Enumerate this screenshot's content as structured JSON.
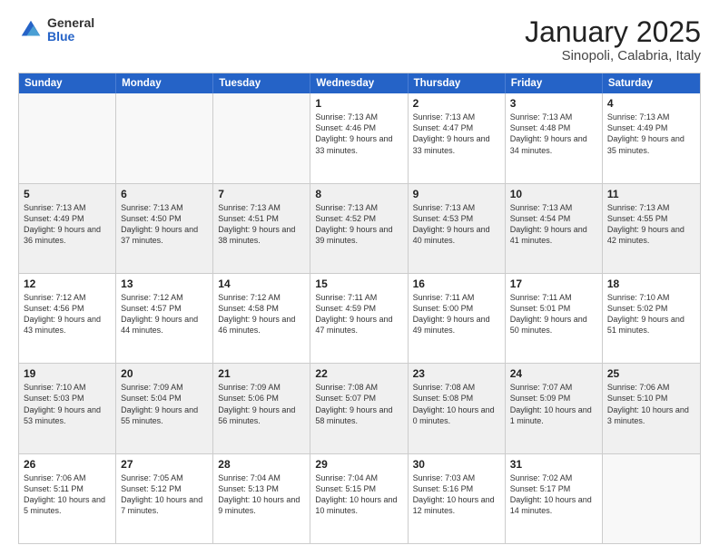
{
  "logo": {
    "general": "General",
    "blue": "Blue"
  },
  "header": {
    "month": "January 2025",
    "location": "Sinopoli, Calabria, Italy"
  },
  "weekdays": [
    "Sunday",
    "Monday",
    "Tuesday",
    "Wednesday",
    "Thursday",
    "Friday",
    "Saturday"
  ],
  "rows": [
    [
      {
        "day": "",
        "info": "",
        "shaded": false,
        "empty": true
      },
      {
        "day": "",
        "info": "",
        "shaded": false,
        "empty": true
      },
      {
        "day": "",
        "info": "",
        "shaded": false,
        "empty": true
      },
      {
        "day": "1",
        "info": "Sunrise: 7:13 AM\nSunset: 4:46 PM\nDaylight: 9 hours and 33 minutes.",
        "shaded": false,
        "empty": false
      },
      {
        "day": "2",
        "info": "Sunrise: 7:13 AM\nSunset: 4:47 PM\nDaylight: 9 hours and 33 minutes.",
        "shaded": false,
        "empty": false
      },
      {
        "day": "3",
        "info": "Sunrise: 7:13 AM\nSunset: 4:48 PM\nDaylight: 9 hours and 34 minutes.",
        "shaded": false,
        "empty": false
      },
      {
        "day": "4",
        "info": "Sunrise: 7:13 AM\nSunset: 4:49 PM\nDaylight: 9 hours and 35 minutes.",
        "shaded": false,
        "empty": false
      }
    ],
    [
      {
        "day": "5",
        "info": "Sunrise: 7:13 AM\nSunset: 4:49 PM\nDaylight: 9 hours and 36 minutes.",
        "shaded": true,
        "empty": false
      },
      {
        "day": "6",
        "info": "Sunrise: 7:13 AM\nSunset: 4:50 PM\nDaylight: 9 hours and 37 minutes.",
        "shaded": true,
        "empty": false
      },
      {
        "day": "7",
        "info": "Sunrise: 7:13 AM\nSunset: 4:51 PM\nDaylight: 9 hours and 38 minutes.",
        "shaded": true,
        "empty": false
      },
      {
        "day": "8",
        "info": "Sunrise: 7:13 AM\nSunset: 4:52 PM\nDaylight: 9 hours and 39 minutes.",
        "shaded": true,
        "empty": false
      },
      {
        "day": "9",
        "info": "Sunrise: 7:13 AM\nSunset: 4:53 PM\nDaylight: 9 hours and 40 minutes.",
        "shaded": true,
        "empty": false
      },
      {
        "day": "10",
        "info": "Sunrise: 7:13 AM\nSunset: 4:54 PM\nDaylight: 9 hours and 41 minutes.",
        "shaded": true,
        "empty": false
      },
      {
        "day": "11",
        "info": "Sunrise: 7:13 AM\nSunset: 4:55 PM\nDaylight: 9 hours and 42 minutes.",
        "shaded": true,
        "empty": false
      }
    ],
    [
      {
        "day": "12",
        "info": "Sunrise: 7:12 AM\nSunset: 4:56 PM\nDaylight: 9 hours and 43 minutes.",
        "shaded": false,
        "empty": false
      },
      {
        "day": "13",
        "info": "Sunrise: 7:12 AM\nSunset: 4:57 PM\nDaylight: 9 hours and 44 minutes.",
        "shaded": false,
        "empty": false
      },
      {
        "day": "14",
        "info": "Sunrise: 7:12 AM\nSunset: 4:58 PM\nDaylight: 9 hours and 46 minutes.",
        "shaded": false,
        "empty": false
      },
      {
        "day": "15",
        "info": "Sunrise: 7:11 AM\nSunset: 4:59 PM\nDaylight: 9 hours and 47 minutes.",
        "shaded": false,
        "empty": false
      },
      {
        "day": "16",
        "info": "Sunrise: 7:11 AM\nSunset: 5:00 PM\nDaylight: 9 hours and 49 minutes.",
        "shaded": false,
        "empty": false
      },
      {
        "day": "17",
        "info": "Sunrise: 7:11 AM\nSunset: 5:01 PM\nDaylight: 9 hours and 50 minutes.",
        "shaded": false,
        "empty": false
      },
      {
        "day": "18",
        "info": "Sunrise: 7:10 AM\nSunset: 5:02 PM\nDaylight: 9 hours and 51 minutes.",
        "shaded": false,
        "empty": false
      }
    ],
    [
      {
        "day": "19",
        "info": "Sunrise: 7:10 AM\nSunset: 5:03 PM\nDaylight: 9 hours and 53 minutes.",
        "shaded": true,
        "empty": false
      },
      {
        "day": "20",
        "info": "Sunrise: 7:09 AM\nSunset: 5:04 PM\nDaylight: 9 hours and 55 minutes.",
        "shaded": true,
        "empty": false
      },
      {
        "day": "21",
        "info": "Sunrise: 7:09 AM\nSunset: 5:06 PM\nDaylight: 9 hours and 56 minutes.",
        "shaded": true,
        "empty": false
      },
      {
        "day": "22",
        "info": "Sunrise: 7:08 AM\nSunset: 5:07 PM\nDaylight: 9 hours and 58 minutes.",
        "shaded": true,
        "empty": false
      },
      {
        "day": "23",
        "info": "Sunrise: 7:08 AM\nSunset: 5:08 PM\nDaylight: 10 hours and 0 minutes.",
        "shaded": true,
        "empty": false
      },
      {
        "day": "24",
        "info": "Sunrise: 7:07 AM\nSunset: 5:09 PM\nDaylight: 10 hours and 1 minute.",
        "shaded": true,
        "empty": false
      },
      {
        "day": "25",
        "info": "Sunrise: 7:06 AM\nSunset: 5:10 PM\nDaylight: 10 hours and 3 minutes.",
        "shaded": true,
        "empty": false
      }
    ],
    [
      {
        "day": "26",
        "info": "Sunrise: 7:06 AM\nSunset: 5:11 PM\nDaylight: 10 hours and 5 minutes.",
        "shaded": false,
        "empty": false
      },
      {
        "day": "27",
        "info": "Sunrise: 7:05 AM\nSunset: 5:12 PM\nDaylight: 10 hours and 7 minutes.",
        "shaded": false,
        "empty": false
      },
      {
        "day": "28",
        "info": "Sunrise: 7:04 AM\nSunset: 5:13 PM\nDaylight: 10 hours and 9 minutes.",
        "shaded": false,
        "empty": false
      },
      {
        "day": "29",
        "info": "Sunrise: 7:04 AM\nSunset: 5:15 PM\nDaylight: 10 hours and 10 minutes.",
        "shaded": false,
        "empty": false
      },
      {
        "day": "30",
        "info": "Sunrise: 7:03 AM\nSunset: 5:16 PM\nDaylight: 10 hours and 12 minutes.",
        "shaded": false,
        "empty": false
      },
      {
        "day": "31",
        "info": "Sunrise: 7:02 AM\nSunset: 5:17 PM\nDaylight: 10 hours and 14 minutes.",
        "shaded": false,
        "empty": false
      },
      {
        "day": "",
        "info": "",
        "shaded": false,
        "empty": true
      }
    ]
  ]
}
